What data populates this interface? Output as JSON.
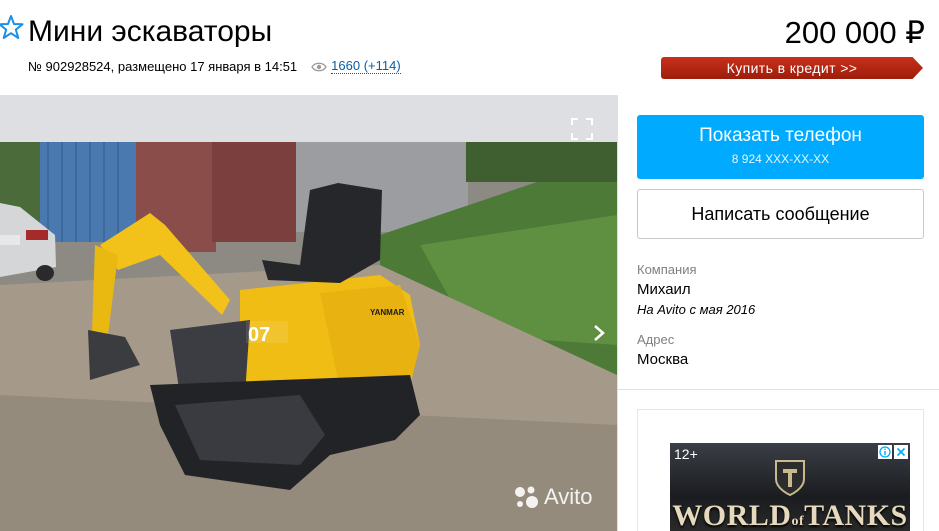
{
  "listing": {
    "title": "Мини эскаваторы",
    "meta_text": "№ 902928524, размещено 17 января в 14:51",
    "views": "1660 (+114)",
    "price": "200 000 ₽",
    "credit_label": "Купить в кредит >>"
  },
  "gallery": {
    "watermark": "Avito",
    "machine_badge": "07",
    "brand_text": "YANMAR"
  },
  "contact": {
    "phone_label": "Показать телефон",
    "phone_masked": "8 924 XXX-XX-XX",
    "message_label": "Написать сообщение"
  },
  "seller": {
    "company_label": "Компания",
    "name": "Михаил",
    "since": "На Avito с мая 2016",
    "address_label": "Адрес",
    "address": "Москва"
  },
  "ad": {
    "age_rating": "12+",
    "logo_left": "WORLD",
    "logo_mid": "of",
    "logo_right": "TANKS"
  },
  "colors": {
    "accent_blue": "#00aaff",
    "credit_red": "#b0230f",
    "link_blue": "#0b5ea6"
  }
}
